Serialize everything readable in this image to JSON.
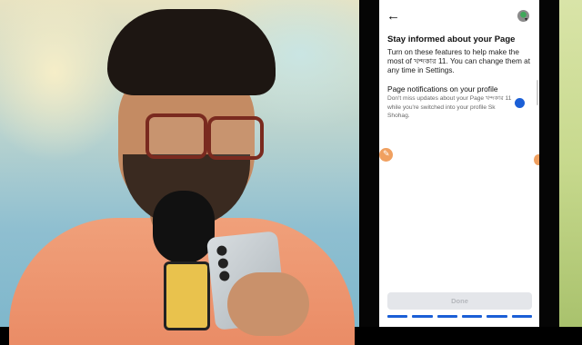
{
  "screen": {
    "title": "Stay informed about your Page",
    "intro": "Turn on these features to help make the most of খন্দকার 11. You can change them at any time in Settings.",
    "setting": {
      "label": "Page notifications on your profile",
      "description": "Don't miss updates about your Page খন্দকার 11 while you're switched into your profile Sk Shohag.",
      "enabled": true
    },
    "done_label": "Done",
    "progress_steps": 6,
    "progress_completed": 6
  },
  "icons": {
    "back": "back-arrow-icon",
    "avatar": "profile-avatar-icon",
    "edit": "pencil-icon"
  },
  "colors": {
    "accent": "#1b5fd6",
    "done_button_bg": "#e4e6ea",
    "done_button_text": "#b5b8bd"
  }
}
